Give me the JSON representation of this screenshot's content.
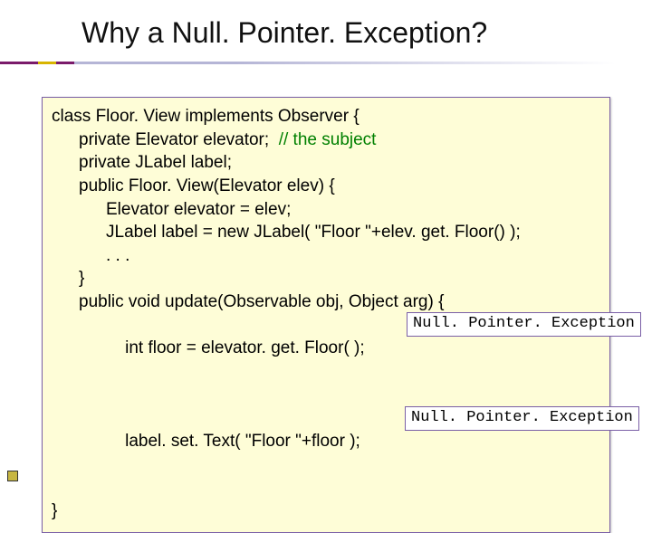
{
  "title": "Why a Null. Pointer. Exception?",
  "code": {
    "l0": "class Floor. View implements Observer {",
    "l1a": "private Elevator elevator;  ",
    "l1b": "// the subject",
    "l2": "private JLabel label;",
    "l3": "public Floor. View(Elevator elev) {",
    "l4": "Elevator elevator = elev;",
    "l5": "JLabel label = new JLabel( \"Floor \"+elev. get. Floor() );",
    "l6": ". . .",
    "l7": "}",
    "l8": "public void update(Observable obj, Object arg) {",
    "l9": "int floor = elevator. get. Floor( );",
    "l10": "label. set. Text( \"Floor \"+floor );",
    "l11": "}"
  },
  "exception": {
    "a": "Null. Pointer. Exception",
    "b": "Null. Pointer. Exception"
  }
}
